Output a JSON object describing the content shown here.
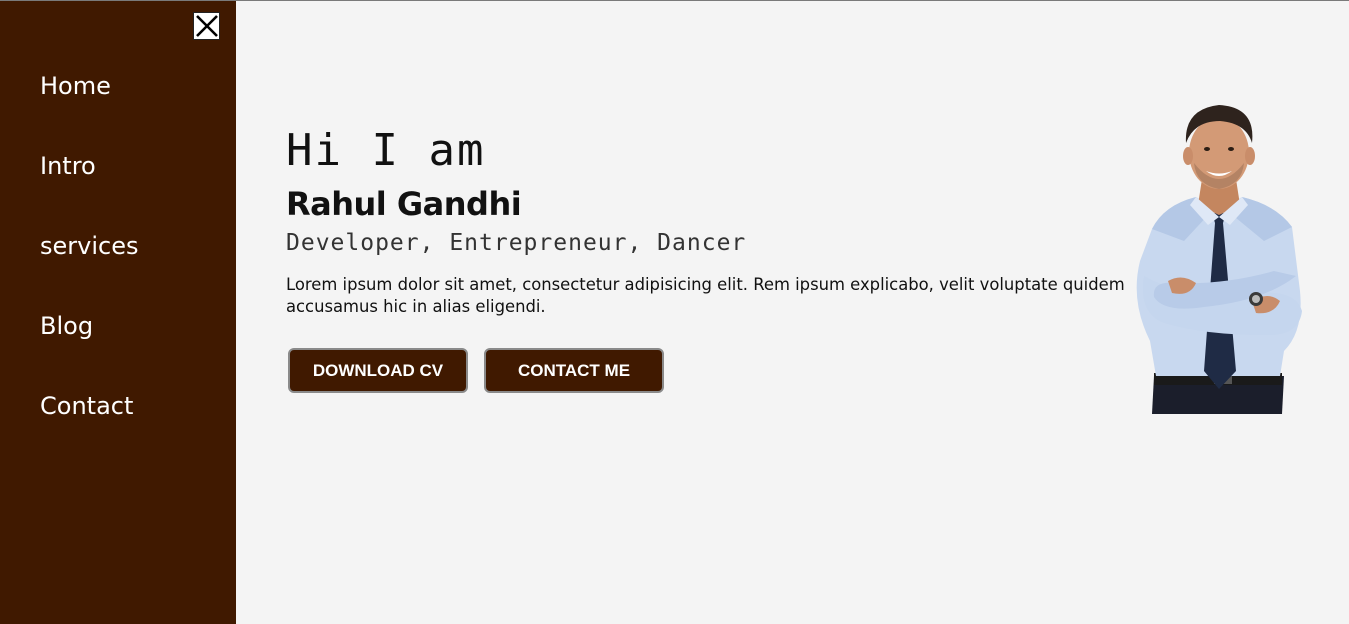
{
  "sidebar": {
    "close_icon": "close-x-icon",
    "items": [
      {
        "label": "Home"
      },
      {
        "label": "Intro"
      },
      {
        "label": "services"
      },
      {
        "label": "Blog"
      },
      {
        "label": "Contact"
      }
    ]
  },
  "hero": {
    "greeting": "Hi I am",
    "name": "Rahul Gandhi",
    "roles": "Developer, Entrepreneur, Dancer",
    "description": "Lorem ipsum dolor sit amet, consectetur adipisicing elit. Rem ipsum explicabo, velit voluptate quidem accusamus hic in alias eligendi.",
    "buttons": {
      "download_cv": "DOWNLOAD CV",
      "contact_me": "CONTACT ME"
    },
    "portrait_icon": "profile-photo"
  },
  "colors": {
    "sidebar_bg": "#401900",
    "page_bg": "#f4f4f4",
    "button_bg": "#401900"
  }
}
